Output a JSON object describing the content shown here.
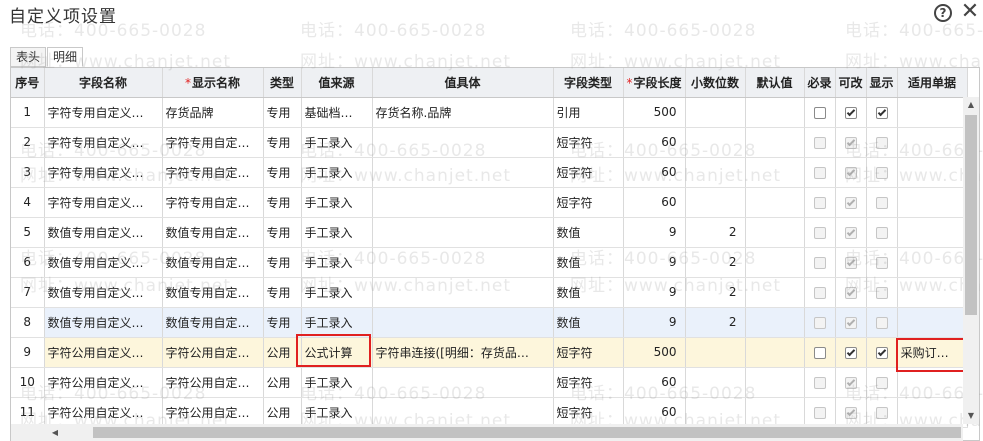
{
  "window": {
    "title": "自定义项设置",
    "help_glyph": "?",
    "close_glyph": "✕"
  },
  "tabs": [
    {
      "label": "表头",
      "active": false
    },
    {
      "label": "明细",
      "active": true
    }
  ],
  "watermark": {
    "phone": "电话：400-665-0028",
    "web": "网址：www.chanjet.net"
  },
  "grid": {
    "columns": [
      {
        "label": "序号",
        "required": false
      },
      {
        "label": "字段名称",
        "required": false
      },
      {
        "label": "显示名称",
        "required": true
      },
      {
        "label": "类型",
        "required": false
      },
      {
        "label": "值来源",
        "required": false
      },
      {
        "label": "值具体",
        "required": false
      },
      {
        "label": "字段类型",
        "required": false
      },
      {
        "label": "字段长度",
        "required": true
      },
      {
        "label": "小数位数",
        "required": false
      },
      {
        "label": "默认值",
        "required": false
      },
      {
        "label": "必录",
        "required": false
      },
      {
        "label": "可改",
        "required": false
      },
      {
        "label": "显示",
        "required": false
      },
      {
        "label": "适用单据",
        "required": false
      }
    ],
    "rows": [
      {
        "seq": "1",
        "field": "字符专用自定义…",
        "display": "存货品牌",
        "type": "专用",
        "source": "基础档…",
        "detail": "存货名称.品牌",
        "ftype": "引用",
        "len": "500",
        "dec": "",
        "def": "",
        "req": false,
        "edit": true,
        "show": true,
        "bill": "",
        "enabled": true,
        "state": ""
      },
      {
        "seq": "2",
        "field": "字符专用自定义…",
        "display": "字符专用自定…",
        "type": "专用",
        "source": "手工录入",
        "detail": "",
        "ftype": "短字符",
        "len": "60",
        "dec": "",
        "def": "",
        "req": false,
        "edit": true,
        "show": false,
        "bill": "",
        "enabled": false,
        "state": ""
      },
      {
        "seq": "3",
        "field": "字符专用自定义…",
        "display": "字符专用自定…",
        "type": "专用",
        "source": "手工录入",
        "detail": "",
        "ftype": "短字符",
        "len": "60",
        "dec": "",
        "def": "",
        "req": false,
        "edit": true,
        "show": false,
        "bill": "",
        "enabled": false,
        "state": ""
      },
      {
        "seq": "4",
        "field": "字符专用自定义…",
        "display": "字符专用自定…",
        "type": "专用",
        "source": "手工录入",
        "detail": "",
        "ftype": "短字符",
        "len": "60",
        "dec": "",
        "def": "",
        "req": false,
        "edit": true,
        "show": false,
        "bill": "",
        "enabled": false,
        "state": ""
      },
      {
        "seq": "5",
        "field": "数值专用自定义…",
        "display": "数值专用自定…",
        "type": "专用",
        "source": "手工录入",
        "detail": "",
        "ftype": "数值",
        "len": "9",
        "dec": "2",
        "def": "",
        "req": false,
        "edit": true,
        "show": false,
        "bill": "",
        "enabled": false,
        "state": ""
      },
      {
        "seq": "6",
        "field": "数值专用自定义…",
        "display": "数值专用自定…",
        "type": "专用",
        "source": "手工录入",
        "detail": "",
        "ftype": "数值",
        "len": "9",
        "dec": "2",
        "def": "",
        "req": false,
        "edit": true,
        "show": false,
        "bill": "",
        "enabled": false,
        "state": ""
      },
      {
        "seq": "7",
        "field": "数值专用自定义…",
        "display": "数值专用自定…",
        "type": "专用",
        "source": "手工录入",
        "detail": "",
        "ftype": "数值",
        "len": "9",
        "dec": "2",
        "def": "",
        "req": false,
        "edit": true,
        "show": false,
        "bill": "",
        "enabled": false,
        "state": ""
      },
      {
        "seq": "8",
        "field": "数值专用自定义…",
        "display": "数值专用自定…",
        "type": "专用",
        "source": "手工录入",
        "detail": "",
        "ftype": "数值",
        "len": "9",
        "dec": "2",
        "def": "",
        "req": false,
        "edit": true,
        "show": false,
        "bill": "",
        "enabled": false,
        "state": "hover"
      },
      {
        "seq": "9",
        "field": "字符公用自定义…",
        "display": "字符公用自定…",
        "type": "公用",
        "source": "公式计算",
        "detail": "字符串连接([明细：存货品…",
        "ftype": "短字符",
        "len": "500",
        "dec": "",
        "def": "",
        "req": false,
        "edit": true,
        "show": true,
        "bill": "采购订…",
        "enabled": true,
        "state": "selected"
      },
      {
        "seq": "10",
        "field": "字符公用自定义…",
        "display": "字符公用自定…",
        "type": "公用",
        "source": "手工录入",
        "detail": "",
        "ftype": "短字符",
        "len": "60",
        "dec": "",
        "def": "",
        "req": false,
        "edit": true,
        "show": false,
        "bill": "",
        "enabled": false,
        "state": ""
      },
      {
        "seq": "11",
        "field": "字符公用自定义…",
        "display": "字符公用自定…",
        "type": "公用",
        "source": "手工录入",
        "detail": "",
        "ftype": "短字符",
        "len": "60",
        "dec": "",
        "def": "",
        "req": false,
        "edit": true,
        "show": false,
        "bill": "",
        "enabled": false,
        "state": ""
      }
    ]
  },
  "icons": {
    "scroll_up": "up-arrow-icon",
    "scroll_down": "down-arrow-icon",
    "scroll_left": "left-arrow-icon"
  },
  "colors": {
    "required_star": "#e02020",
    "highlight_box": "#e02020",
    "hover_row": "#eaf1fb",
    "selected_row": "#fdf6dc"
  }
}
